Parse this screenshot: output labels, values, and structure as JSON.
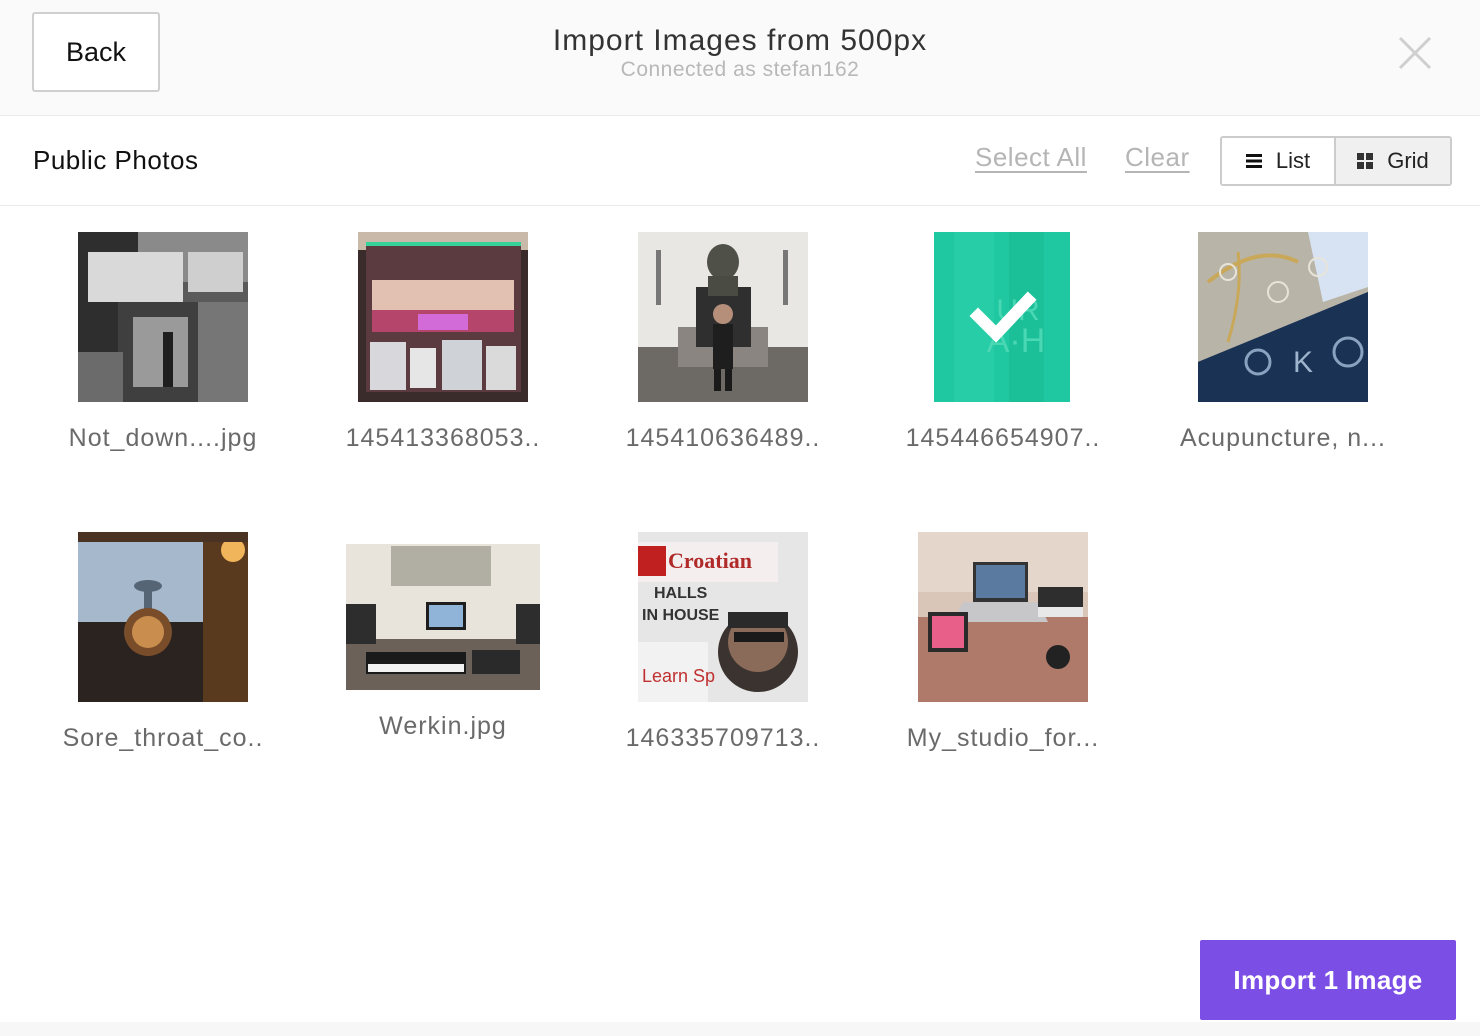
{
  "header": {
    "back_label": "Back",
    "title": "Import Images from 500px",
    "subtitle": "Connected as stefan162",
    "close_icon": "close-icon"
  },
  "toolbar": {
    "section_title": "Public Photos",
    "select_all_label": "Select All",
    "clear_label": "Clear",
    "view_options": [
      {
        "label": "List",
        "icon": "list-icon",
        "active": false
      },
      {
        "label": "Grid",
        "icon": "grid-icon",
        "active": true
      }
    ]
  },
  "photos": [
    {
      "caption": "Not_down....jpg",
      "selected": false
    },
    {
      "caption": "145413368053..",
      "selected": false
    },
    {
      "caption": "145410636489..",
      "selected": false
    },
    {
      "caption": "145446654907..",
      "selected": true
    },
    {
      "caption": "Acupuncture, n...",
      "selected": false
    },
    {
      "caption": "Sore_throat_co..",
      "selected": false
    },
    {
      "caption": "Werkin.jpg",
      "selected": false
    },
    {
      "caption": "146335709713..",
      "selected": false
    },
    {
      "caption": "My_studio_for...",
      "selected": false
    }
  ],
  "footer": {
    "import_label": "Import 1 Image"
  },
  "colors": {
    "accent": "#7b4ee6",
    "selected_overlay": "#1fc8a0"
  }
}
